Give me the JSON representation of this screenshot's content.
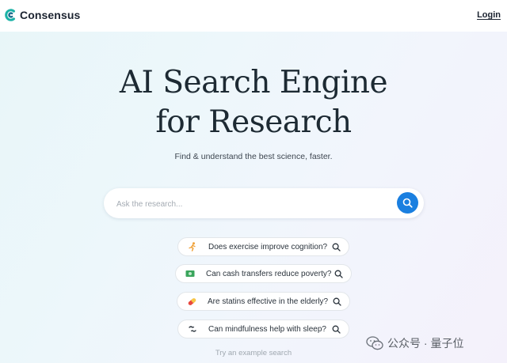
{
  "header": {
    "brand_name": "Consensus",
    "login_label": "Login"
  },
  "hero": {
    "title_line1": "AI Search Engine",
    "title_line2": "for Research",
    "subtitle": "Find & understand the best science, faster."
  },
  "search": {
    "placeholder": "Ask the research...",
    "value": ""
  },
  "suggestions": [
    {
      "icon": "running-person-icon",
      "text": "Does exercise improve cognition?"
    },
    {
      "icon": "cash-icon",
      "text": "Can cash transfers reduce poverty?"
    },
    {
      "icon": "pill-icon",
      "text": "Are statins effective in the elderly?"
    },
    {
      "icon": "loop-icon",
      "text": "Can mindfulness help with sleep?"
    }
  ],
  "example_hint": "Try an example search",
  "watermark": {
    "text": "公众号 · 量子位",
    "icon": "wechat-icon"
  },
  "colors": {
    "accent": "#1a7fe0",
    "brand_teal": "#1bb2a6"
  }
}
